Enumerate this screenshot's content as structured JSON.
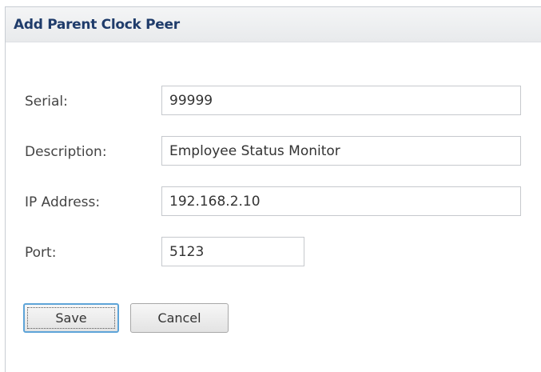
{
  "dialog": {
    "title": "Add Parent Clock Peer"
  },
  "form": {
    "serial": {
      "label": "Serial:",
      "value": "99999"
    },
    "description": {
      "label": "Description:",
      "value": "Employee Status Monitor"
    },
    "ip_address": {
      "label": "IP Address:",
      "value": "192.168.2.10"
    },
    "port": {
      "label": "Port:",
      "value": "5123"
    }
  },
  "actions": {
    "save_label": "Save",
    "cancel_label": "Cancel"
  },
  "colors": {
    "title": "#1f3c6b",
    "header_bg": "#e8eaec",
    "focus_border": "#5ea4d8"
  }
}
